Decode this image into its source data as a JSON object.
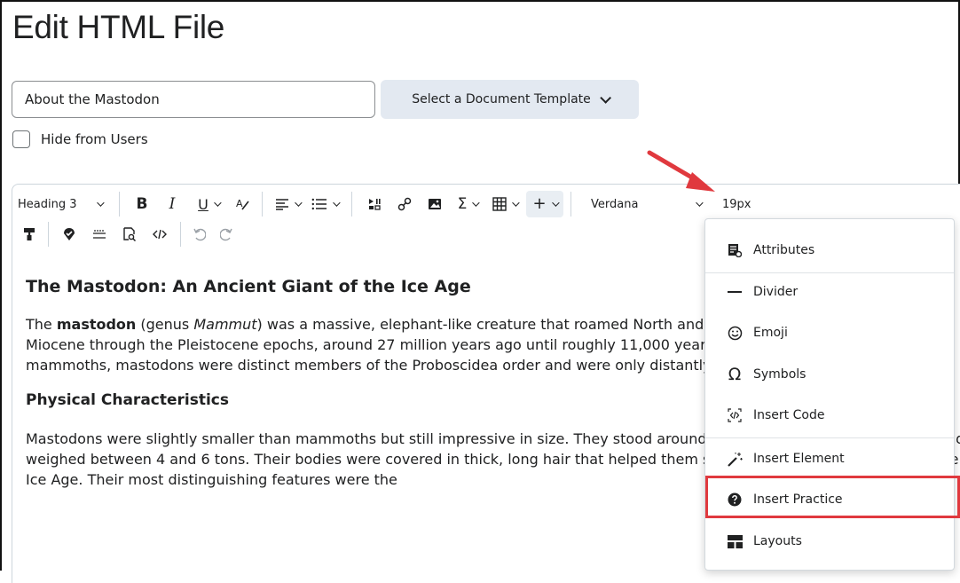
{
  "page": {
    "title": "Edit HTML File"
  },
  "form": {
    "title_value": "About the Mastodon",
    "template_button": "Select a Document Template",
    "hide_label": "Hide from Users"
  },
  "toolbar": {
    "block_format": "Heading 3",
    "font_family": "Verdana",
    "font_size": "19px",
    "bold": "B",
    "italic": "I",
    "underline": "U"
  },
  "content": {
    "heading": "The Mastodon: An Ancient Giant of the Ice Age",
    "p1_a": "The ",
    "p1_bold": "mastodon",
    "p1_b": " (genus ",
    "p1_italic": "Mammut",
    "p1_c": ") was a massive, elephant-like creature that roamed North and Central America during the late Miocene through the Pleistocene epochs, around 27 million years ago until roughly 11,000 years ago. Often confused with mammoths, mastodons were distinct members of the Proboscidea order and were only distantly related to modern elephants.",
    "subheading": "Physical Characteristics",
    "p2": "Mastodons were slightly smaller than mammoths but still impressive in size. They stood around 8 to 10 feet tall at the shoulder and weighed between 4 and 6 tons. Their bodies were covered in thick, long hair that helped them survive in the colder climates of the Ice Age. Their most distinguishing features were the"
  },
  "insert_menu": {
    "items": [
      {
        "label": "Attributes",
        "icon": "attributes-icon"
      },
      {
        "label": "Divider",
        "icon": "divider-icon"
      },
      {
        "label": "Emoji",
        "icon": "emoji-icon"
      },
      {
        "label": "Symbols",
        "icon": "omega-icon"
      },
      {
        "label": "Insert Code",
        "icon": "code-icon"
      },
      {
        "label": "Insert Element",
        "icon": "magic-wand-icon"
      },
      {
        "label": "Insert Practice",
        "icon": "help-circle-icon"
      },
      {
        "label": "Layouts",
        "icon": "layouts-icon"
      }
    ]
  },
  "colors": {
    "accent_red": "#e0393e",
    "template_button_bg": "#e3e9f1"
  }
}
